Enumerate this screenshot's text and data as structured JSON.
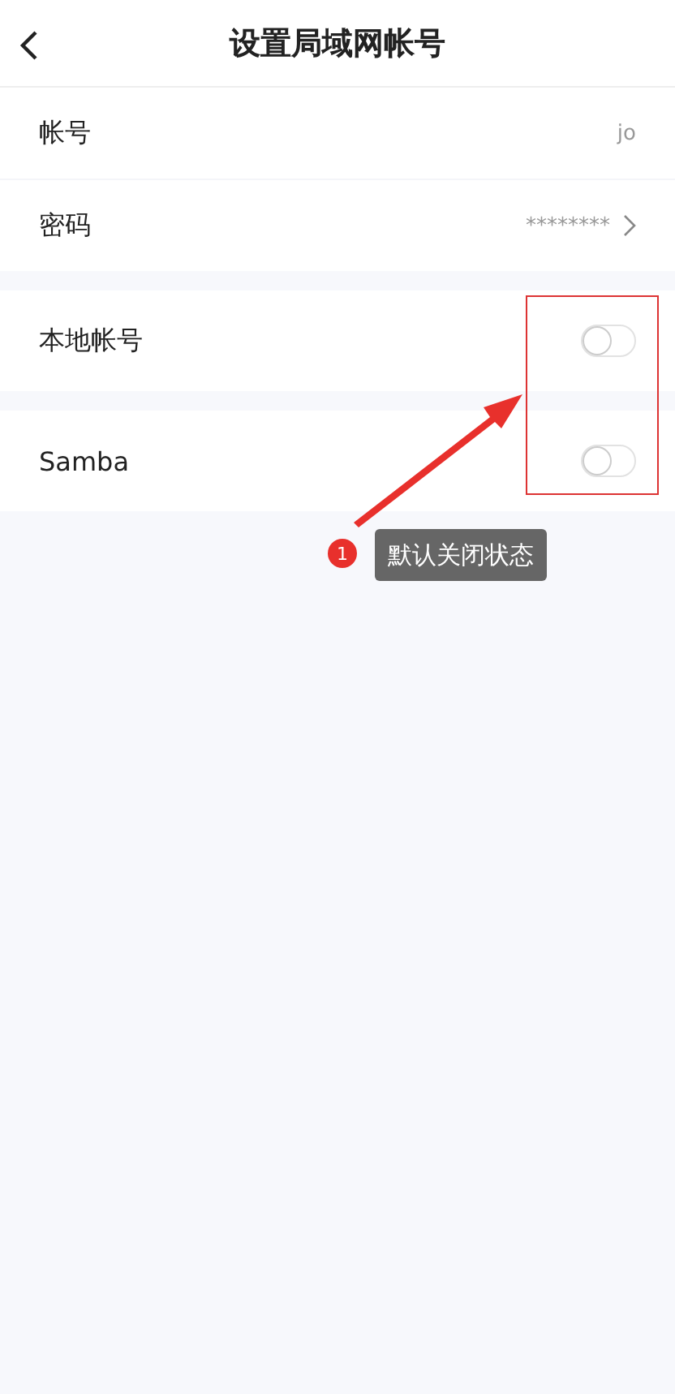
{
  "header": {
    "title": "设置局域网帐号"
  },
  "sections": [
    {
      "rows": [
        {
          "kind": "value",
          "label": "帐号",
          "value": "jo",
          "chevron": false
        },
        {
          "kind": "value",
          "label": "密码",
          "value": "********",
          "chevron": true
        }
      ]
    },
    {
      "rows": [
        {
          "kind": "toggle",
          "label": "本地帐号",
          "on": false
        }
      ]
    },
    {
      "rows": [
        {
          "kind": "toggle",
          "label": "Samba",
          "on": false
        }
      ]
    }
  ],
  "annotation": {
    "number": "1",
    "text": "默认关闭状态"
  }
}
